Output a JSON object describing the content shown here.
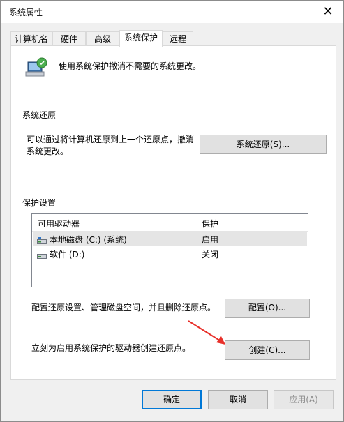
{
  "window": {
    "title": "系统属性",
    "close_glyph": "✕"
  },
  "tabs": [
    {
      "label": "计算机名"
    },
    {
      "label": "硬件"
    },
    {
      "label": "高级"
    },
    {
      "label": "系统保护",
      "active": true
    },
    {
      "label": "远程"
    }
  ],
  "intro": {
    "text": "使用系统保护撤消不需要的系统更改。",
    "icon": "system-protection-icon"
  },
  "system_restore": {
    "heading": "系统还原",
    "description": "可以通过将计算机还原到上一个还原点，撤消系统更改。",
    "button": "系统还原(S)..."
  },
  "protection": {
    "heading": "保护设置",
    "columns": [
      "可用驱动器",
      "保护"
    ],
    "rows": [
      {
        "drive": "本地磁盘 (C:) (系统)",
        "status": "启用",
        "icon": "system-drive-icon",
        "selected": true
      },
      {
        "drive": "软件 (D:)",
        "status": "关闭",
        "icon": "drive-icon",
        "selected": false
      }
    ]
  },
  "configure": {
    "text": "配置还原设置、管理磁盘空间，并且删除还原点。",
    "button": "配置(O)..."
  },
  "create": {
    "text": "立刻为启用系统保护的驱动器创建还原点。",
    "button": "创建(C)..."
  },
  "footer": {
    "ok": "确定",
    "cancel": "取消",
    "apply": "应用(A)"
  },
  "colors": {
    "accent": "#0078d7",
    "annotation_arrow": "#e8302a"
  }
}
